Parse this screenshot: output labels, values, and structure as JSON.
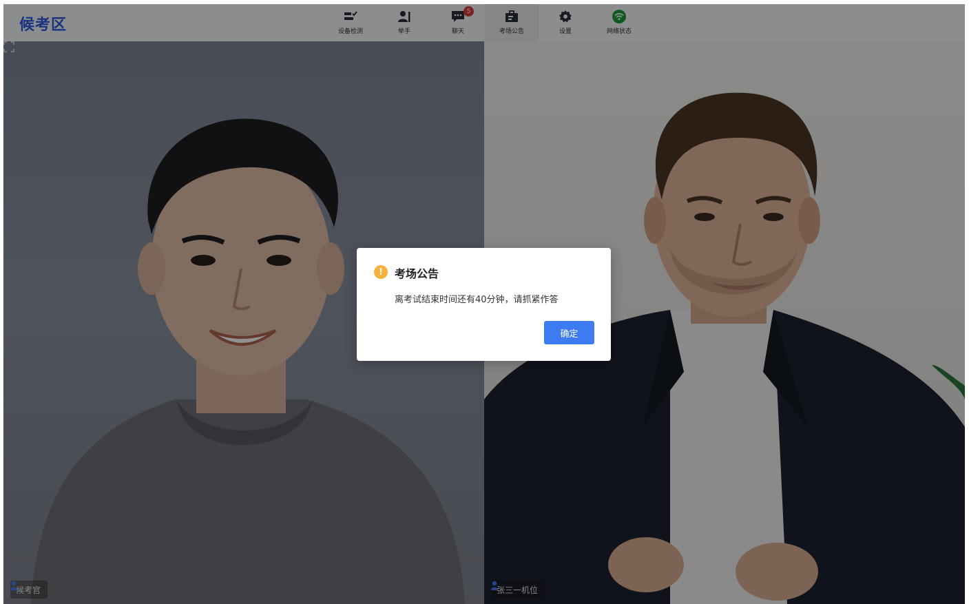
{
  "header": {
    "title": "候考区",
    "accent_color": "#2b5be0"
  },
  "toolbar": {
    "items": [
      {
        "label": "设备检测",
        "icon": "device-check-icon"
      },
      {
        "label": "举手",
        "icon": "raise-hand-icon"
      },
      {
        "label": "聊天",
        "icon": "chat-icon",
        "badge": "5"
      },
      {
        "label": "考场公告",
        "icon": "announcement-icon",
        "active": true
      },
      {
        "label": "设置",
        "icon": "gear-icon"
      },
      {
        "label": "网络状态",
        "icon": "wifi-icon",
        "status_color": "#1f9d3a"
      }
    ]
  },
  "videos": {
    "left": {
      "name": "候考官"
    },
    "right": {
      "name": "张三一机位"
    }
  },
  "dialog": {
    "title": "考场公告",
    "message": "离考试结束时间还有40分钟，请抓紧作答",
    "confirm_label": "确定",
    "icon": "warning-icon",
    "button_color": "#3c7bf0"
  }
}
